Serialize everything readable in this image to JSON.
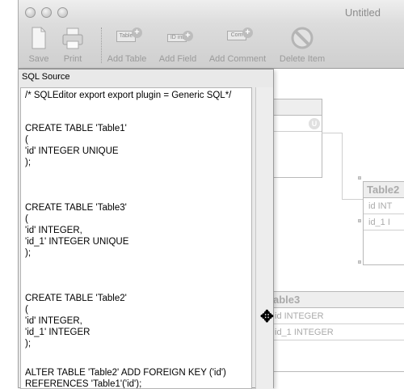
{
  "window": {
    "title": "Untitled"
  },
  "toolbar": {
    "save": "Save",
    "print": "Print",
    "add_table": "Add Table",
    "add_field": "Add Field",
    "add_comment": "Add Comment",
    "delete_item": "Delete Item",
    "table_icon_text": "Table",
    "field_icon_text": "ID int",
    "comment_icon_text": "Com"
  },
  "sql_panel": {
    "title": "SQL Source",
    "lines": [
      "/* SQLEditor export export plugin = Generic SQL*/",
      "CREATE TABLE 'Table1'",
      "(",
      "'id' INTEGER UNIQUE",
      ");",
      "CREATE TABLE 'Table3'",
      "(",
      "'id' INTEGER,",
      "'id_1' INTEGER UNIQUE",
      ");",
      "CREATE TABLE 'Table2'",
      "(",
      "'id' INTEGER,",
      "'id_1' INTEGER",
      ");",
      "ALTER TABLE 'Table2' ADD FOREIGN KEY ('id')",
      "REFERENCES 'Table1'('id');"
    ]
  },
  "diagram": {
    "table1": {
      "unique_marker": "U"
    },
    "table2": {
      "name": "Table2",
      "rows": [
        "id  INT",
        "id_1  I"
      ]
    },
    "table3": {
      "name": "able3",
      "rows": [
        "id  INTEGER",
        "id_1  INTEGER"
      ]
    }
  }
}
